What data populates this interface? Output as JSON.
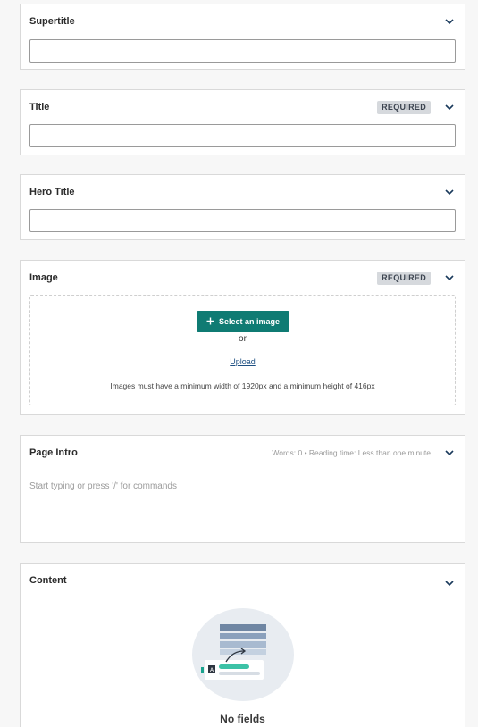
{
  "fields": {
    "supertitle": {
      "label": "Supertitle",
      "value": ""
    },
    "title": {
      "label": "Title",
      "badge": "REQUIRED",
      "value": ""
    },
    "hero_title": {
      "label": "Hero Title",
      "value": ""
    },
    "image": {
      "label": "Image",
      "badge": "REQUIRED",
      "select_button_label": "Select an image",
      "or_text": "or",
      "upload_link": "Upload",
      "hint": "Images must have a minimum width of 1920px and a minimum height of 416px"
    },
    "page_intro": {
      "label": "Page Intro",
      "stats": "Words: 0 • Reading time: Less than one minute",
      "placeholder": "Start typing or press '/' for commands"
    },
    "content": {
      "label": "Content",
      "empty_state": "No fields"
    }
  },
  "icons": {
    "chevron": "chevron-down-icon",
    "plus": "plus-icon",
    "illustration": "no-fields-illustration"
  },
  "colors": {
    "accent": "#0f7b73",
    "badge_bg": "#d6d9dd",
    "link": "#1d4f82",
    "chevron": "#1a3a5c"
  }
}
